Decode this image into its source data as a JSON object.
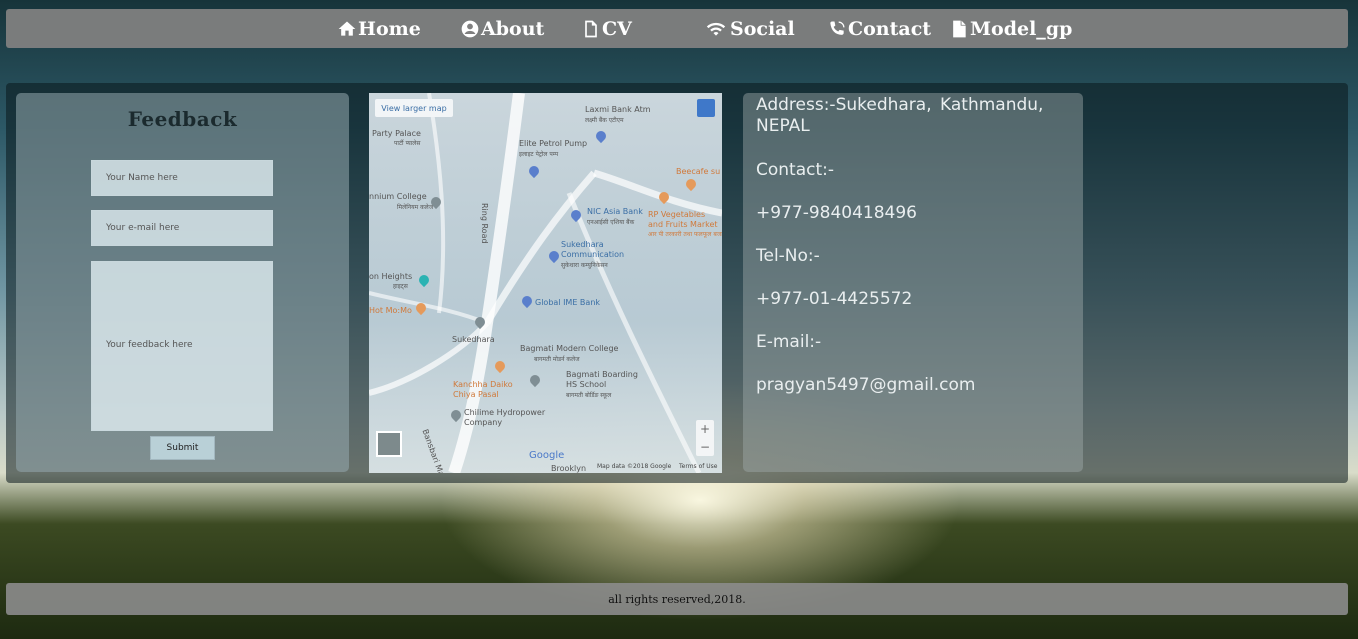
{
  "nav": {
    "items": [
      {
        "label": "Home",
        "icon": "home-icon"
      },
      {
        "label": "About",
        "icon": "user-icon"
      },
      {
        "label": "CV",
        "icon": "file-icon"
      },
      {
        "label": "Social",
        "icon": "wifi-icon"
      },
      {
        "label": "Contact",
        "icon": "phone-icon"
      },
      {
        "label": "Model_gp",
        "icon": "document-icon"
      }
    ]
  },
  "feedback": {
    "title": "Feedback",
    "name_placeholder": "Your Name here",
    "email_placeholder": "Your e-mail here",
    "feedback_placeholder": "Your feedback here",
    "submit_label": "Submit"
  },
  "map": {
    "view_larger": "View larger map",
    "labels": [
      "Laxmi Bank Atm",
      "लक्ष्मी बैंक एटीएम",
      "Party Palace",
      "पार्टी प्यालेस",
      "Elite Petrol Pump",
      "इलाइट पेट्रोल पम्प",
      "Beecafe su",
      "nnium College",
      "मिलेनियम कलेज",
      "NIC Asia Bank",
      "एनआईसी एशिया बैंक",
      "RP Vegetables",
      "and Fruits Market",
      "आर पी तरकारी तथा फलफूल बजार",
      "Ring Road",
      "Sukedhara",
      "Communication",
      "सुकेधारा कम्युनिकेसन",
      "on Heights",
      "हाइट्स",
      "Global IME Bank",
      "Hot Mo:Mo",
      "Sukedhara",
      "Bagmati Modern College",
      "बागमती मोडर्न कलेज",
      "Bagmati Boarding",
      "HS School",
      "बागमती बोर्डिङ स्कूल",
      "Kanchha Daiko",
      "Chiya Pasal",
      "Chilime Hydropower",
      "Company",
      "Bansbari Marg",
      "Brooklyn"
    ],
    "zoom_in": "+",
    "zoom_out": "−",
    "google": "Google",
    "map_data": "Map data ©2018 Google",
    "terms": "Terms of Use"
  },
  "contact": {
    "address": "Address:-Sukedhara, Kathmandu, NEPAL",
    "contact_label": "Contact:-",
    "mobile": "+977-9840418496",
    "tel_label": "Tel-No:-",
    "tel": "+977-01-4425572",
    "email_label": "E-mail:-",
    "email": "pragyan5497@gmail.com"
  },
  "footer": {
    "text": "all rights reserved,2018."
  },
  "colors": {
    "nav_bg": "#808080",
    "text_light": "#ffffff",
    "map_blue": "#3a6ea5",
    "map_orange": "#d0793a"
  }
}
